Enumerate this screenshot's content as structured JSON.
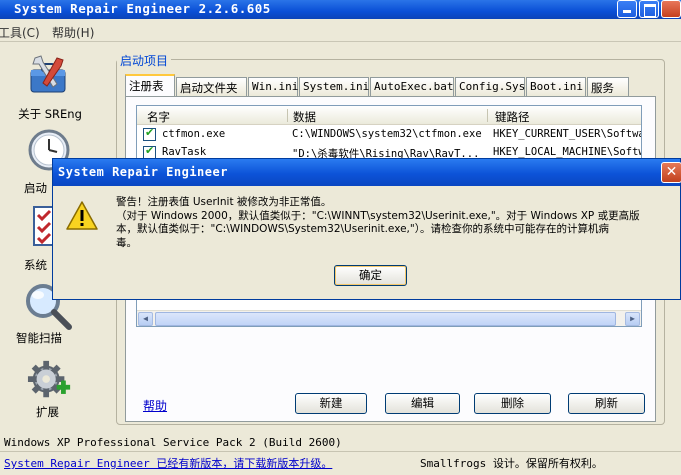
{
  "window": {
    "title": "System Repair Engineer 2.2.6.605"
  },
  "menu": {
    "tools": "工具(C)",
    "help": "帮助(H)"
  },
  "nav": {
    "about": "关于 SREng",
    "startup": "启动",
    "system": "系统",
    "smart_scan": "智能扫描",
    "extension": "扩展"
  },
  "group": {
    "title": "启动项目"
  },
  "tabs": [
    "注册表",
    "启动文件夹",
    "Win.ini",
    "System.ini",
    "AutoExec.bat",
    "Config.Sys",
    "Boot.ini",
    "服务"
  ],
  "list": {
    "headers": [
      "名字",
      "数据",
      "键路径"
    ],
    "rows": [
      {
        "name": "ctfmon.exe",
        "data": "C:\\WINDOWS\\system32\\ctfmon.exe",
        "path": "HKEY_CURRENT_USER\\Softwa"
      },
      {
        "name": "RavTask",
        "data": "\"D:\\杀毒软件\\Rising\\Rav\\RavT...",
        "path": "HKEY_LOCAL_MACHINE\\Softwa"
      }
    ]
  },
  "help_link": "帮助",
  "buttons": {
    "new": "新建",
    "edit": "编辑",
    "delete": "删除",
    "refresh": "刷新"
  },
  "status": {
    "os": "Windows XP Professional Service Pack 2 (Build 2600)",
    "update": "System Repair Engineer 已经有新版本，请下载新版本升级。",
    "copyright": "Smallfrogs 设计。保留所有权利。"
  },
  "dialog": {
    "title": "System Repair Engineer",
    "line1": "警告！注册表值 UserInit 被修改为非正常值。",
    "line2": "（对于 Windows 2000，默认值类似于：\"C:\\WINNT\\system32\\Userinit.exe,\"。对于 Windows XP 或更高版",
    "line3": "本，默认值类似于：\"C:\\WINDOWS\\System32\\Userinit.exe,\"）。请检查你的系统中可能存在的计算机病",
    "line4": "毒。",
    "ok": "确定"
  }
}
